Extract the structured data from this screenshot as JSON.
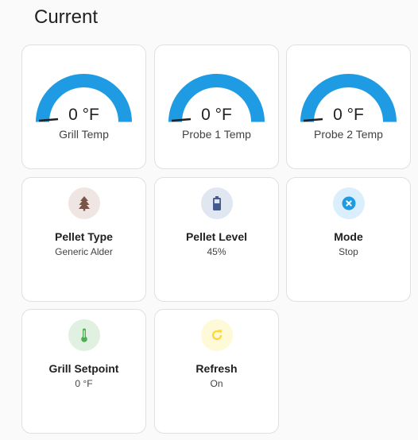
{
  "section": {
    "title": "Current"
  },
  "colors": {
    "gauge_arc": "#1e9be3",
    "needle": "#212121",
    "pellet_type_icon": "#795548",
    "pellet_level_icon": "#455a8f",
    "mode_icon": "#1e9be3",
    "setpoint_icon": "#4caf50",
    "refresh_icon": "#fdd835"
  },
  "gauges": [
    {
      "value": "0 °F",
      "label": "Grill Temp",
      "level": 0
    },
    {
      "value": "0 °F",
      "label": "Probe 1 Temp",
      "level": 0
    },
    {
      "value": "0 °F",
      "label": "Probe 2 Temp",
      "level": 0
    }
  ],
  "tiles": [
    {
      "name": "Pellet Type",
      "state": "Generic Alder",
      "icon": "pine-tree-icon"
    },
    {
      "name": "Pellet Level",
      "state": "45%",
      "icon": "battery-icon"
    },
    {
      "name": "Mode",
      "state": "Stop",
      "icon": "close-circle-icon"
    },
    {
      "name": "Grill Setpoint",
      "state": "0 °F",
      "icon": "thermometer-icon"
    },
    {
      "name": "Refresh",
      "state": "On",
      "icon": "refresh-icon"
    }
  ]
}
